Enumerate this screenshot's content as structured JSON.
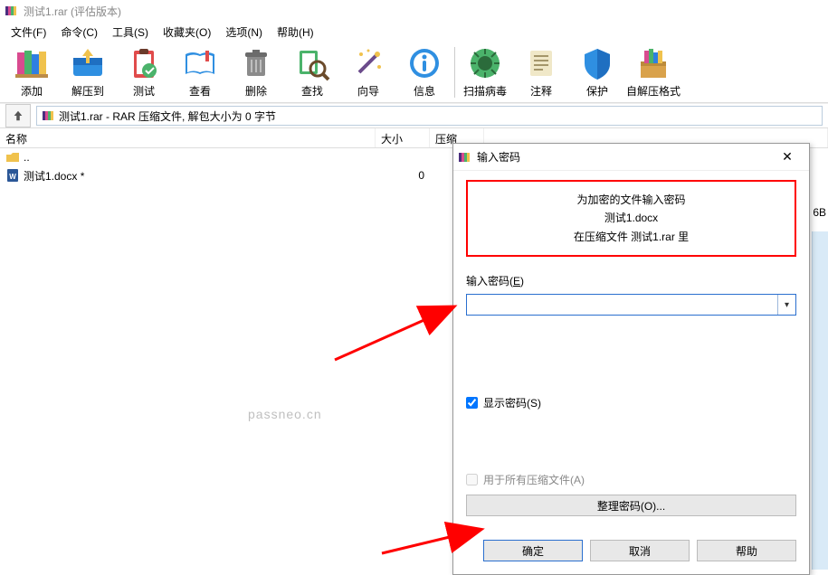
{
  "titlebar": {
    "title": "测试1.rar (评估版本)"
  },
  "menu": {
    "file": "文件(F)",
    "command": "命令(C)",
    "tools": "工具(S)",
    "favorites": "收藏夹(O)",
    "options": "选项(N)",
    "help": "帮助(H)"
  },
  "toolbar": {
    "add": "添加",
    "extract_to": "解压到",
    "test": "测试",
    "view": "查看",
    "delete": "删除",
    "find": "查找",
    "wizard": "向导",
    "info": "信息",
    "scan": "扫描病毒",
    "comment": "注释",
    "protect": "保护",
    "sfx": "自解压格式"
  },
  "address": {
    "text": "测试1.rar - RAR 压缩文件, 解包大小为 0 字节"
  },
  "columns": {
    "name": "名称",
    "size": "大小",
    "ratio": "压缩"
  },
  "rows": {
    "up": {
      "name": ".."
    },
    "doc": {
      "name": "测试1.docx *",
      "size": "0"
    }
  },
  "rightfrag": "6B",
  "watermark": "passneo.cn",
  "dialog": {
    "title": "输入密码",
    "msg_line1": "为加密的文件输入密码",
    "msg_line2": "测试1.docx",
    "msg_line3": "在压缩文件 测试1.rar 里",
    "pw_label_pre": "输入密码(",
    "pw_label_u": "E",
    "pw_label_post": ")",
    "show_pw_pre": "显示密码(",
    "show_pw_u": "S",
    "show_pw_post": ")",
    "show_pw_checked": true,
    "all_archives_pre": "用于所有压缩文件(",
    "all_archives_u": "A",
    "all_archives_post": ")",
    "organize": "整理密码(O)...",
    "ok": "确定",
    "cancel": "取消",
    "help": "帮助"
  }
}
